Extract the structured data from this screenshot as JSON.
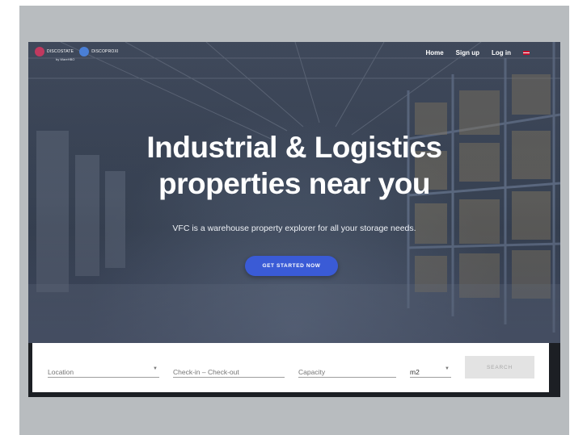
{
  "header": {
    "logo_left": "DISCOSTATE",
    "logo_right": "DISCOPROXI",
    "logo_sub": "by WareHBO",
    "nav": [
      "Home",
      "Sign up",
      "Log in"
    ]
  },
  "hero": {
    "headline_line1": "Industrial & Logistics",
    "headline_line2": "properties near you",
    "subline": "VFC is a warehouse property explorer for all your storage needs.",
    "cta_label": "GET STARTED NOW"
  },
  "search": {
    "location_placeholder": "Location",
    "dates_placeholder": "Check-in – Check-out",
    "capacity_placeholder": "Capacity",
    "unit_value": "m2",
    "search_label": "SEARCH"
  },
  "colors": {
    "accent": "#3a5bd6",
    "frame": "#b8bcbf"
  }
}
